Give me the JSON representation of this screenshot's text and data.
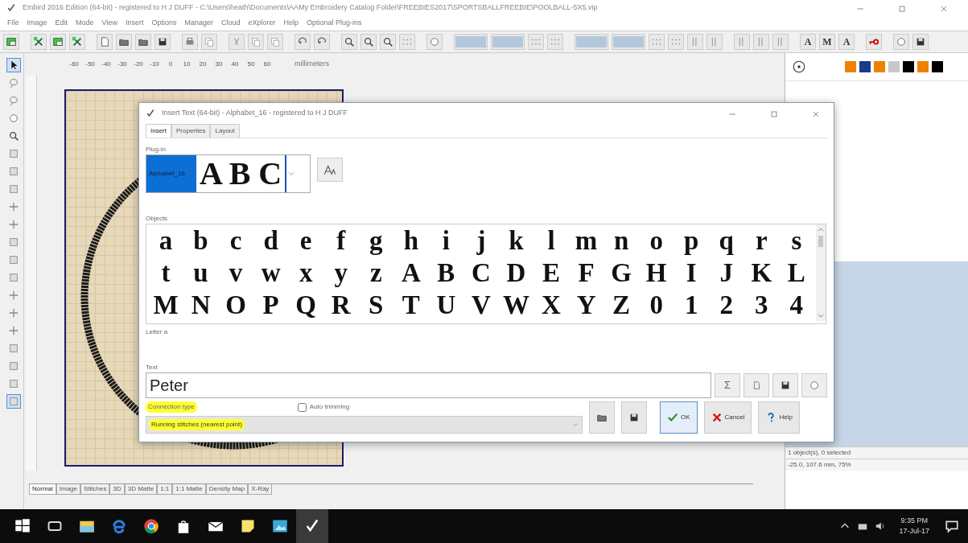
{
  "window": {
    "title": "Embird 2016 Edition (64-bit) - registered to H J DUFF - C:\\Users\\heath\\Documents\\AAMy Embroidery Catalog Folder\\FREEBIES2017\\SPORTSBALLFREEBIE\\POOLBALL-5X5.vip"
  },
  "menu": [
    "File",
    "Image",
    "Edit",
    "Mode",
    "View",
    "Insert",
    "Options",
    "Manager",
    "Cloud",
    "eXplorer",
    "Help",
    "Optional Plug-ins"
  ],
  "text_tools": [
    "A",
    "M",
    "A"
  ],
  "left_tools": [
    {
      "selected": true
    },
    {
      "selected": false
    },
    {
      "selected": false
    },
    {
      "selected": false
    },
    {
      "selected": false
    },
    {
      "selected": false
    },
    {
      "selected": false
    },
    {
      "selected": false
    },
    {
      "selected": false
    },
    {
      "selected": false
    },
    {
      "selected": false
    },
    {
      "selected": false
    },
    {
      "selected": false
    },
    {
      "selected": false
    },
    {
      "selected": false
    },
    {
      "selected": false
    },
    {
      "selected": false
    },
    {
      "selected": false
    },
    {
      "selected": false
    },
    {
      "selected": true
    }
  ],
  "ruler": {
    "labels": [
      "-60",
      "-50",
      "-40",
      "-30",
      "-20",
      "-10",
      "0",
      "10",
      "20",
      "30",
      "40",
      "50",
      "60"
    ],
    "unit": "millimeters"
  },
  "palette": [
    {
      "color": "#f08000"
    },
    {
      "color": "#1a3a8a"
    },
    {
      "color": "#f08000"
    },
    {
      "color": "#c8c8c8"
    },
    {
      "color": "#000000"
    },
    {
      "color": "#f08000"
    },
    {
      "color": "#000000"
    }
  ],
  "status": {
    "objects": "1 object(s), 0 selected",
    "position": "-25.0, 107.6 mm, 75%"
  },
  "view_tabs": [
    {
      "label": "Normal",
      "selected": true
    },
    {
      "label": "Image",
      "selected": false
    },
    {
      "label": "Stitches",
      "selected": false
    },
    {
      "label": "3D",
      "selected": false
    },
    {
      "label": "3D Matte",
      "selected": false
    },
    {
      "label": "1:1",
      "selected": false
    },
    {
      "label": "1:1 Matte",
      "selected": false
    },
    {
      "label": "Density Map",
      "selected": false
    },
    {
      "label": "X-Ray",
      "selected": false
    }
  ],
  "dialog": {
    "title": "Insert Text (64-bit) - Alphabet_16 - registered to H J DUFF",
    "tabs": [
      {
        "label": "Insert",
        "selected": true
      },
      {
        "label": "Properties",
        "selected": false
      },
      {
        "label": "Layout",
        "selected": false
      }
    ],
    "plugin_label": "Plug-in",
    "plugin": {
      "name": "Alphabet_16",
      "preview": "A B C"
    },
    "objects_label": "Objects",
    "glyphs": [
      [
        "a",
        "b",
        "c",
        "d",
        "e",
        "f",
        "g",
        "h",
        "i",
        "j",
        "k",
        "l",
        "m",
        "n",
        "o",
        "p",
        "q",
        "r",
        "s"
      ],
      [
        "t",
        "u",
        "v",
        "w",
        "x",
        "y",
        "z",
        "A",
        "B",
        "C",
        "D",
        "E",
        "F",
        "G",
        "H",
        "I",
        "J",
        "K",
        "L"
      ],
      [
        "M",
        "N",
        "O",
        "P",
        "Q",
        "R",
        "S",
        "T",
        "U",
        "V",
        "W",
        "X",
        "Y",
        "Z",
        "0",
        "1",
        "2",
        "3",
        "4"
      ]
    ],
    "letter_info": "Letter a",
    "text_label": "Text",
    "text_value": "Peter",
    "text_tool_icons": [
      "Σ"
    ],
    "connection": {
      "label": "Connection type",
      "value": "Running stitches (nearest point)",
      "highlighted": true
    },
    "auto_trimming": {
      "label": "Auto trimming",
      "checked": false
    },
    "buttons": [
      {
        "kind": "open"
      },
      {
        "kind": "save"
      },
      {
        "kind": "ok",
        "label": "OK"
      },
      {
        "kind": "cancel",
        "label": "Cancel"
      },
      {
        "kind": "help",
        "label": "Help"
      }
    ]
  },
  "taskbar": {
    "apps": [
      {
        "active": false
      },
      {
        "active": false
      },
      {
        "active": false
      },
      {
        "active": false
      },
      {
        "active": false
      },
      {
        "active": false
      },
      {
        "active": false
      },
      {
        "active": false
      },
      {
        "active": false
      },
      {
        "active": true
      }
    ],
    "time": "9:35 PM",
    "date": "17-Jul-17"
  }
}
